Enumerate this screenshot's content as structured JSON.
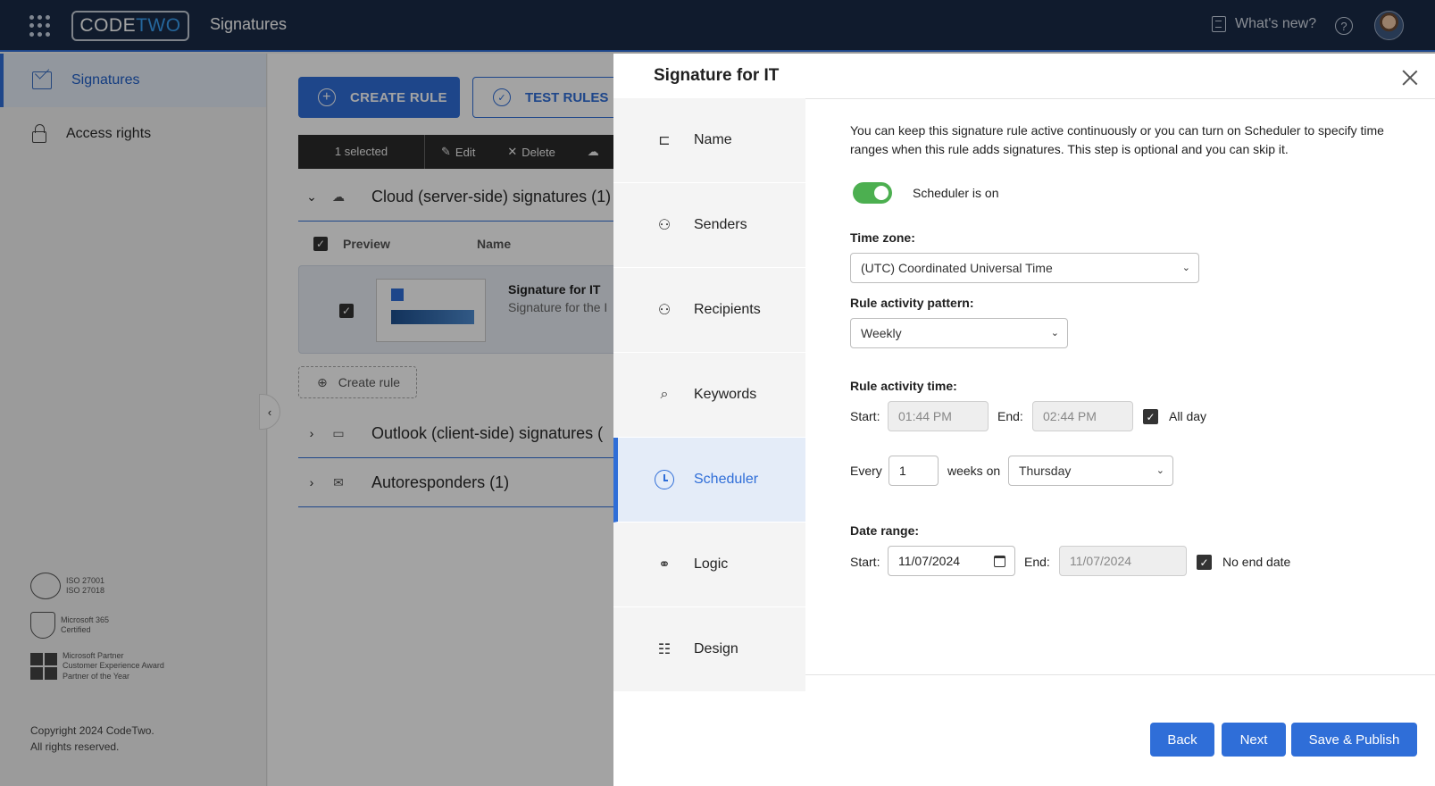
{
  "topbar": {
    "logo_code": "CODE",
    "logo_two": "TWO",
    "app_title": "Signatures",
    "whats_new": "What's new?",
    "help": "?"
  },
  "sidebar": {
    "items": [
      {
        "label": "Signatures",
        "icon": "mail-signature-icon",
        "active": true
      },
      {
        "label": "Access rights",
        "icon": "lock-icon",
        "active": false
      }
    ],
    "certs": [
      {
        "line1": "ISO 27001",
        "line2": "ISO 27018"
      },
      {
        "line1": "Microsoft 365",
        "line2": "Certified"
      },
      {
        "line1": "Microsoft Partner",
        "line2": "Customer Experience Award",
        "line3": "Partner of the Year"
      }
    ],
    "copyright_line1": "Copyright 2024 CodeTwo.",
    "copyright_line2": "All rights reserved."
  },
  "main": {
    "create_rule": "CREATE RULE",
    "test_rules": "TEST RULES",
    "toolbar": {
      "selected": "1 selected",
      "edit": "Edit",
      "delete": "Delete"
    },
    "sections": [
      {
        "label": "Cloud (server-side) signatures (1)",
        "expanded": true
      },
      {
        "label": "Outlook (client-side) signatures (",
        "expanded": false
      },
      {
        "label": "Autoresponders (1)",
        "expanded": false
      }
    ],
    "table_headers": {
      "preview": "Preview",
      "name": "Name"
    },
    "row": {
      "name": "Signature for IT",
      "description": "Signature for the I"
    },
    "create_rule_small": "Create rule"
  },
  "drawer": {
    "title": "Signature for IT",
    "steps": [
      {
        "label": "Name",
        "icon": "signpost-icon"
      },
      {
        "label": "Senders",
        "icon": "senders-icon"
      },
      {
        "label": "Recipients",
        "icon": "recipients-icon"
      },
      {
        "label": "Keywords",
        "icon": "keywords-icon"
      },
      {
        "label": "Scheduler",
        "icon": "clock-icon",
        "active": true
      },
      {
        "label": "Logic",
        "icon": "logic-icon"
      },
      {
        "label": "Design",
        "icon": "design-icon"
      }
    ],
    "intro": "You can keep this signature rule active continuously or you can turn on Scheduler to specify time ranges when this rule adds signatures. This step is optional and you can skip it.",
    "scheduler_toggle": {
      "label": "Scheduler is on",
      "on": true
    },
    "time_zone": {
      "label": "Time zone:",
      "value": "(UTC) Coordinated Universal Time"
    },
    "pattern": {
      "label": "Rule activity pattern:",
      "value": "Weekly"
    },
    "activity_time": {
      "label": "Rule activity time:",
      "start_label": "Start:",
      "start_value": "01:44 PM",
      "end_label": "End:",
      "end_value": "02:44 PM",
      "all_day_label": "All day",
      "all_day": true
    },
    "recurrence": {
      "every_label": "Every",
      "every_value": "1",
      "weeks_on_label": "weeks on",
      "day": "Thursday"
    },
    "date_range": {
      "label": "Date range:",
      "start_label": "Start:",
      "start_value": "11/07/2024",
      "end_label": "End:",
      "end_value": "11/07/2024",
      "no_end_label": "No end date",
      "no_end": true
    },
    "buttons": {
      "back": "Back",
      "next": "Next",
      "save": "Save & Publish"
    }
  },
  "colors": {
    "accent": "#2f6ed8",
    "topbar": "#1a2b47",
    "toggle_on": "#4caf50"
  }
}
